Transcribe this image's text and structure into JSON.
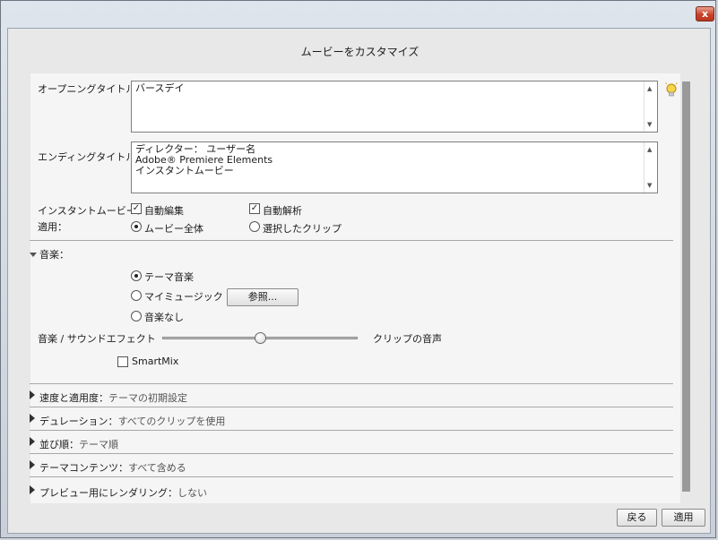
{
  "dialog": {
    "title": "ムービーをカスタマイズ",
    "close_label": "x"
  },
  "opening": {
    "label": "オープニングタイトル：",
    "value": "バースデイ"
  },
  "ending": {
    "label": "エンディングタイトル：",
    "value": "ディレクター： ユーザー名\nAdobe® Premiere Elements\nインスタントムービー"
  },
  "instant_movie": {
    "label": "インスタントムービー：",
    "auto_edit": "自動編集",
    "auto_analyze": "自動解析"
  },
  "apply": {
    "label": "適用：",
    "whole_movie": "ムービー全体",
    "selected_clips": "選択したクリップ"
  },
  "music": {
    "section_label": "音楽：",
    "theme_music": "テーマ音楽",
    "my_music": "マイミュージック",
    "browse_button": "参照...",
    "no_music": "音楽なし",
    "mix_left_label": "音楽 / サウンドエフェクト",
    "mix_right_label": "クリップの音声",
    "mix_level": 0.5,
    "smartmix": "SmartMix"
  },
  "sections": [
    {
      "label": "速度と適用度：",
      "value": "テーマの初期設定"
    },
    {
      "label": "デュレーション：",
      "value": "すべてのクリップを使用"
    },
    {
      "label": "並び順：",
      "value": "テーマ順"
    },
    {
      "label": "テーマコンテンツ：",
      "value": "すべて含める"
    },
    {
      "label": "プレビュー用にレンダリング：",
      "value": "しない"
    }
  ],
  "footer": {
    "back_button": "戻る",
    "apply_button": "適用"
  },
  "colors": {
    "close_button": "#c9432b",
    "panel": "#f5f5f5",
    "scrollbar": "#9a9a9a"
  }
}
